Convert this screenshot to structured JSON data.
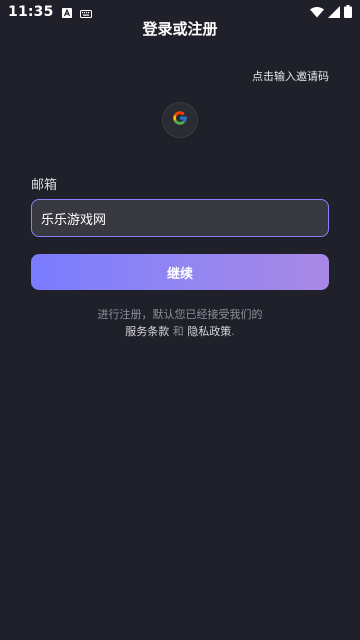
{
  "status_bar": {
    "time": "11:35",
    "icons": [
      "a-letter-icon",
      "keyboard-icon",
      "wifi-icon",
      "signal-icon",
      "battery-icon"
    ]
  },
  "header": {
    "title": "登录或注册"
  },
  "invite_link": "点击输入邀请码",
  "social_login": {
    "provider": "google-icon"
  },
  "email": {
    "label": "邮箱",
    "value": "乐乐游戏网"
  },
  "continue_button": "继续",
  "terms": {
    "line1": "进行注册，默认您已经接受我们的",
    "terms_link": "服务条款",
    "and": "和",
    "privacy_link": "隐私政策",
    "period": "."
  },
  "colors": {
    "background": "#1f2029",
    "input_border": "#8b80ff",
    "button_gradient_start": "#7a7cff",
    "button_gradient_end": "#a988e6"
  }
}
